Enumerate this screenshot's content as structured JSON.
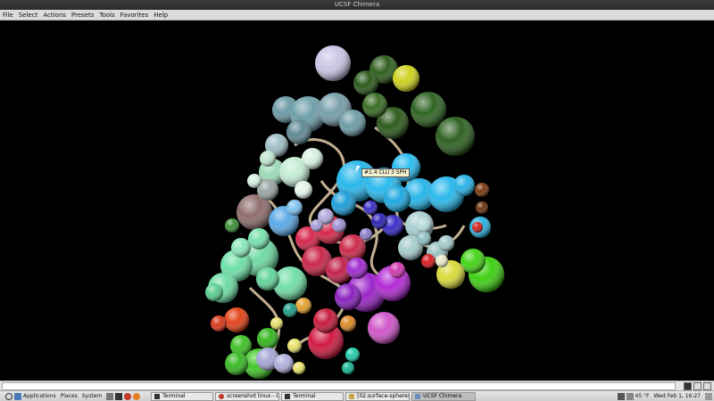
{
  "window": {
    "title": "UCSF Chimera"
  },
  "menu": [
    "File",
    "Select",
    "Actions",
    "Presets",
    "Tools",
    "Favorites",
    "Help"
  ],
  "tooltip": "#1.4 CLU 3 SPH",
  "taskbar": {
    "applications": "Applications",
    "places": "Places",
    "system": "System",
    "tasks": [
      "Terminal",
      "screenshot linux - Go...",
      "Terminal",
      "[02.surface-spheres]",
      "UCSF Chimera"
    ],
    "temperature": "45 °F",
    "clock": "Wed Feb 1, 16:27"
  },
  "colors": {
    "background": "#000000",
    "menubar": "#dcdcdc",
    "ribbon": "#d9c4a2"
  }
}
